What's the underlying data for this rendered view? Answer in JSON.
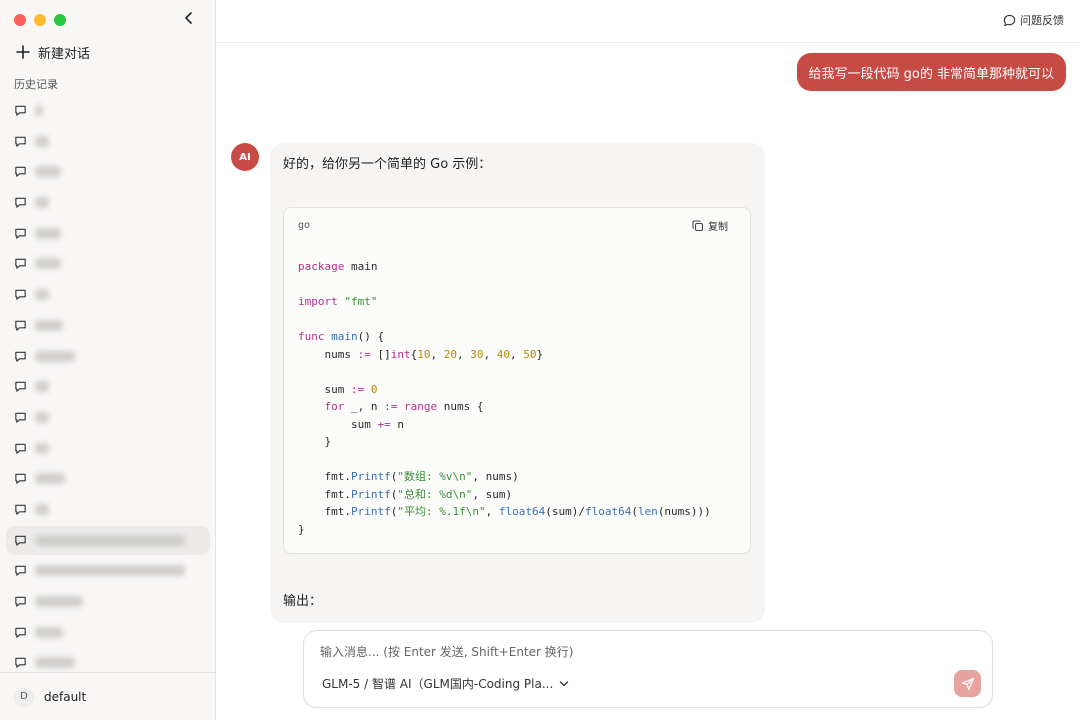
{
  "sidebar": {
    "new_chat_label": "新建对话",
    "history_title": "历史记录",
    "history_items": [
      {
        "w": 8
      },
      {
        "w": 14
      },
      {
        "w": 26
      },
      {
        "w": 14
      },
      {
        "w": 26
      },
      {
        "w": 26
      },
      {
        "w": 14
      },
      {
        "w": 28
      },
      {
        "w": 40
      },
      {
        "w": 14
      },
      {
        "w": 14
      },
      {
        "w": 14
      },
      {
        "w": 30
      },
      {
        "w": 14
      },
      {
        "w": 150
      },
      {
        "w": 150
      },
      {
        "w": 48
      },
      {
        "w": 28
      },
      {
        "w": 40
      }
    ],
    "active_index": 14,
    "footer": {
      "initial": "D",
      "name": "default"
    }
  },
  "topbar": {
    "feedback_label": "问题反馈"
  },
  "conversation": {
    "user_message": "给我写一段代码 go的 非常简单那种就可以",
    "ai_avatar_label": "AI",
    "ai_intro": "好的，给你另一个简单的 Go 示例：",
    "code": {
      "language": "go",
      "copy_label": "复制",
      "lines": [
        [
          {
            "t": "package",
            "c": "kw"
          },
          {
            "t": " main"
          }
        ],
        [],
        [
          {
            "t": "import",
            "c": "kw"
          },
          {
            "t": " "
          },
          {
            "t": "\"fmt\"",
            "c": "str"
          }
        ],
        [],
        [
          {
            "t": "func",
            "c": "kw"
          },
          {
            "t": " "
          },
          {
            "t": "main",
            "c": "fn"
          },
          {
            "t": "() {"
          }
        ],
        [
          {
            "t": "    nums "
          },
          {
            "t": ":=",
            "c": "op"
          },
          {
            "t": " []"
          },
          {
            "t": "int",
            "c": "kw"
          },
          {
            "t": "{"
          },
          {
            "t": "10",
            "c": "num"
          },
          {
            "t": ", "
          },
          {
            "t": "20",
            "c": "num"
          },
          {
            "t": ", "
          },
          {
            "t": "30",
            "c": "num"
          },
          {
            "t": ", "
          },
          {
            "t": "40",
            "c": "num"
          },
          {
            "t": ", "
          },
          {
            "t": "50",
            "c": "num"
          },
          {
            "t": "}"
          }
        ],
        [],
        [
          {
            "t": "    sum "
          },
          {
            "t": ":=",
            "c": "op"
          },
          {
            "t": " "
          },
          {
            "t": "0",
            "c": "num"
          }
        ],
        [
          {
            "t": "    "
          },
          {
            "t": "for",
            "c": "kw"
          },
          {
            "t": " _, n "
          },
          {
            "t": ":=",
            "c": "op"
          },
          {
            "t": " "
          },
          {
            "t": "range",
            "c": "kw"
          },
          {
            "t": " nums {"
          }
        ],
        [
          {
            "t": "        sum "
          },
          {
            "t": "+=",
            "c": "op"
          },
          {
            "t": " n"
          }
        ],
        [
          {
            "t": "    }"
          }
        ],
        [],
        [
          {
            "t": "    fmt."
          },
          {
            "t": "Printf",
            "c": "fn"
          },
          {
            "t": "("
          },
          {
            "t": "\"数组: %v\\n\"",
            "c": "str"
          },
          {
            "t": ", nums)"
          }
        ],
        [
          {
            "t": "    fmt."
          },
          {
            "t": "Printf",
            "c": "fn"
          },
          {
            "t": "("
          },
          {
            "t": "\"总和: %d\\n\"",
            "c": "str"
          },
          {
            "t": ", sum)"
          }
        ],
        [
          {
            "t": "    fmt."
          },
          {
            "t": "Printf",
            "c": "fn"
          },
          {
            "t": "("
          },
          {
            "t": "\"平均: %.1f\\n\"",
            "c": "str"
          },
          {
            "t": ", "
          },
          {
            "t": "float64",
            "c": "fn"
          },
          {
            "t": "(sum)/"
          },
          {
            "t": "float64",
            "c": "fn"
          },
          {
            "t": "("
          },
          {
            "t": "len",
            "c": "fn"
          },
          {
            "t": "(nums)))"
          }
        ],
        [
          {
            "t": "}"
          }
        ]
      ]
    },
    "output_label": "输出："
  },
  "composer": {
    "placeholder": "输入消息... (按 Enter 发送, Shift+Enter 换行)",
    "model_label": "GLM-5 / 智谱 AI（GLM国内-Coding Pla..."
  },
  "colors": {
    "accent": "#c74b45",
    "send_disabled": "#e7a3a0"
  },
  "icons": [
    "plus-icon",
    "chevron-left-icon",
    "chat-bubble-icon",
    "copy-icon",
    "chevron-down-icon",
    "send-icon"
  ]
}
